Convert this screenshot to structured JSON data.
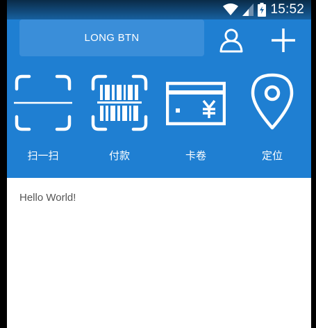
{
  "status_bar": {
    "time": "15:52",
    "icons": [
      "wifi-icon",
      "cell-signal-icon",
      "battery-charging-icon"
    ]
  },
  "header": {
    "long_button_label": "LONG BTN",
    "icons": [
      "user-icon",
      "plus-icon"
    ]
  },
  "shortcuts": [
    {
      "label": "扫一扫",
      "icon": "scan-icon"
    },
    {
      "label": "付款",
      "icon": "barcode-icon"
    },
    {
      "label": "卡卷",
      "icon": "card-icon"
    },
    {
      "label": "定位",
      "icon": "location-pin-icon"
    }
  ],
  "content": {
    "text": "Hello World!"
  },
  "colors": {
    "primary_blue": "#1f7fd2",
    "button_blue": "#3a8ed9",
    "content_bg": "#ffffff",
    "text_gray": "#555555"
  }
}
